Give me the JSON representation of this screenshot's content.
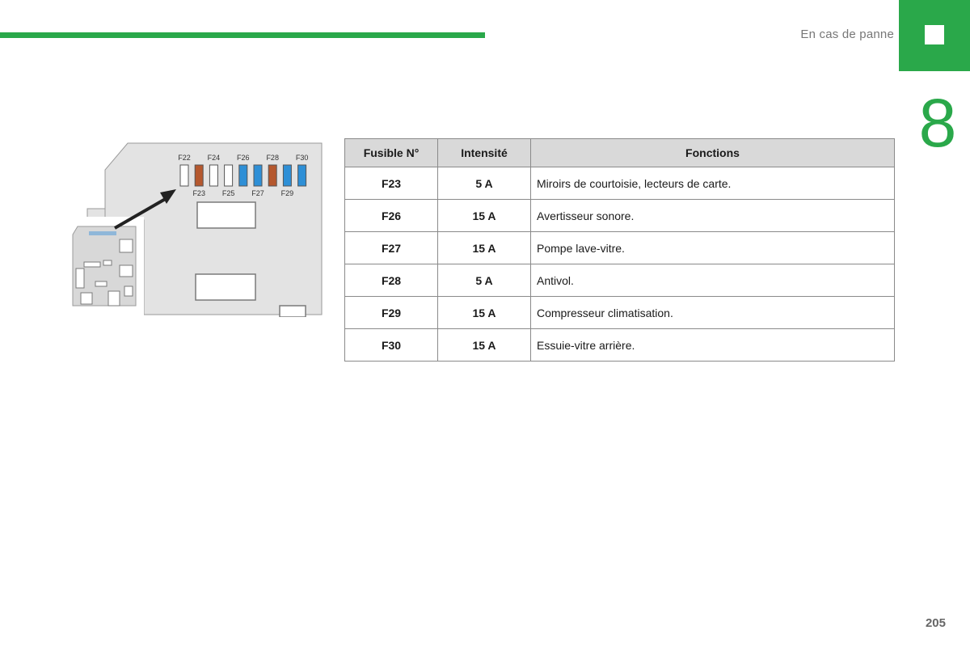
{
  "header": {
    "section_title": "En cas de panne",
    "chapter_number": "8"
  },
  "footer": {
    "page_number": "205"
  },
  "colors": {
    "accent": "#2aa84a",
    "fuse_brown": "#b5582e",
    "fuse_blue": "#2e8fd6",
    "fuse_white": "#ffffff"
  },
  "diagram": {
    "top_labels": [
      "F22",
      "F24",
      "F26",
      "F28",
      "F30"
    ],
    "bottom_labels": [
      "F23",
      "F25",
      "F27",
      "F29"
    ],
    "fuses": [
      {
        "id": "F22",
        "color": "white"
      },
      {
        "id": "F23",
        "color": "brown"
      },
      {
        "id": "F24",
        "color": "white"
      },
      {
        "id": "F25",
        "color": "white"
      },
      {
        "id": "F26",
        "color": "blue"
      },
      {
        "id": "F27",
        "color": "blue"
      },
      {
        "id": "F28",
        "color": "brown"
      },
      {
        "id": "F29",
        "color": "blue"
      },
      {
        "id": "F30",
        "color": "blue"
      }
    ]
  },
  "table": {
    "headers": [
      "Fusible N°",
      "Intensité",
      "Fonctions"
    ],
    "rows": [
      {
        "fuse": "F23",
        "amp": "5 A",
        "function": "Miroirs de courtoisie, lecteurs de carte."
      },
      {
        "fuse": "F26",
        "amp": "15 A",
        "function": "Avertisseur sonore."
      },
      {
        "fuse": "F27",
        "amp": "15 A",
        "function": "Pompe lave-vitre."
      },
      {
        "fuse": "F28",
        "amp": "5 A",
        "function": "Antivol."
      },
      {
        "fuse": "F29",
        "amp": "15 A",
        "function": "Compresseur climatisation."
      },
      {
        "fuse": "F30",
        "amp": "15 A",
        "function": "Essuie-vitre arrière."
      }
    ]
  }
}
